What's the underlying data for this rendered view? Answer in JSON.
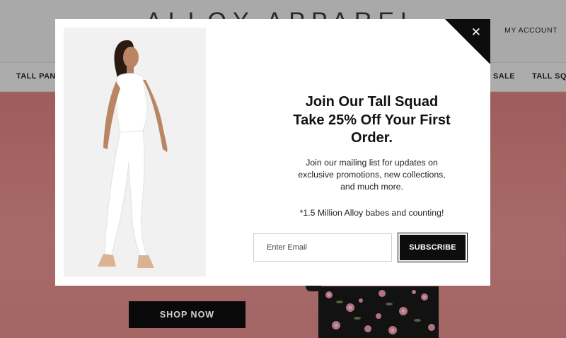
{
  "site": {
    "brand": "ALLOY APPAREL",
    "account_link": "MY ACCOUNT",
    "nav": [
      "TALL PANTS",
      "SALE",
      "TALL SQUAD"
    ],
    "hero_button": "SHOP NOW"
  },
  "popup": {
    "headline_lines": [
      "Join Our Tall Squad",
      "Take 25% Off Your First",
      "Order."
    ],
    "body_lines": [
      "Join our mailing list for updates on",
      "exclusive promotions, new collections,",
      "and much more."
    ],
    "count_text": "*1.5 Million Alloy babes and counting!",
    "email_placeholder": "Enter Email",
    "email_value": "",
    "subscribe_label": "SUBSCRIBE",
    "close_glyph": "✕",
    "close_icon": "close-icon",
    "photo": "model-in-white-outfit"
  },
  "colors": {
    "hero_bg": "#c97b79",
    "header_bg": "#cfcfcf",
    "button_bg": "#0d0d0d",
    "modal_bg": "#ffffff"
  }
}
